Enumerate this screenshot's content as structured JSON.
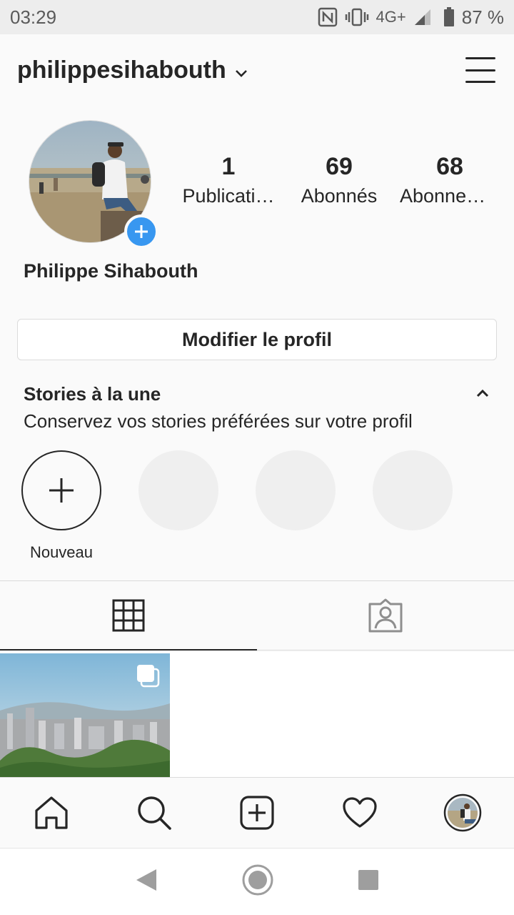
{
  "status_bar": {
    "time": "03:29",
    "network": "4G+",
    "battery": "87 %"
  },
  "header": {
    "username": "philippesihabouth"
  },
  "profile": {
    "full_name": "Philippe Sihabouth",
    "stats": [
      {
        "value": "1",
        "label": "Publicati…"
      },
      {
        "value": "69",
        "label": "Abonnés"
      },
      {
        "value": "68",
        "label": "Abonnem…"
      }
    ],
    "edit_button": "Modifier le profil"
  },
  "highlights": {
    "title": "Stories à la une",
    "subtitle": "Conservez vos stories préférées sur votre profil",
    "new_label": "Nouveau"
  },
  "colors": {
    "accent": "#3897f0",
    "text": "#262626",
    "border": "#dbdbdb"
  }
}
